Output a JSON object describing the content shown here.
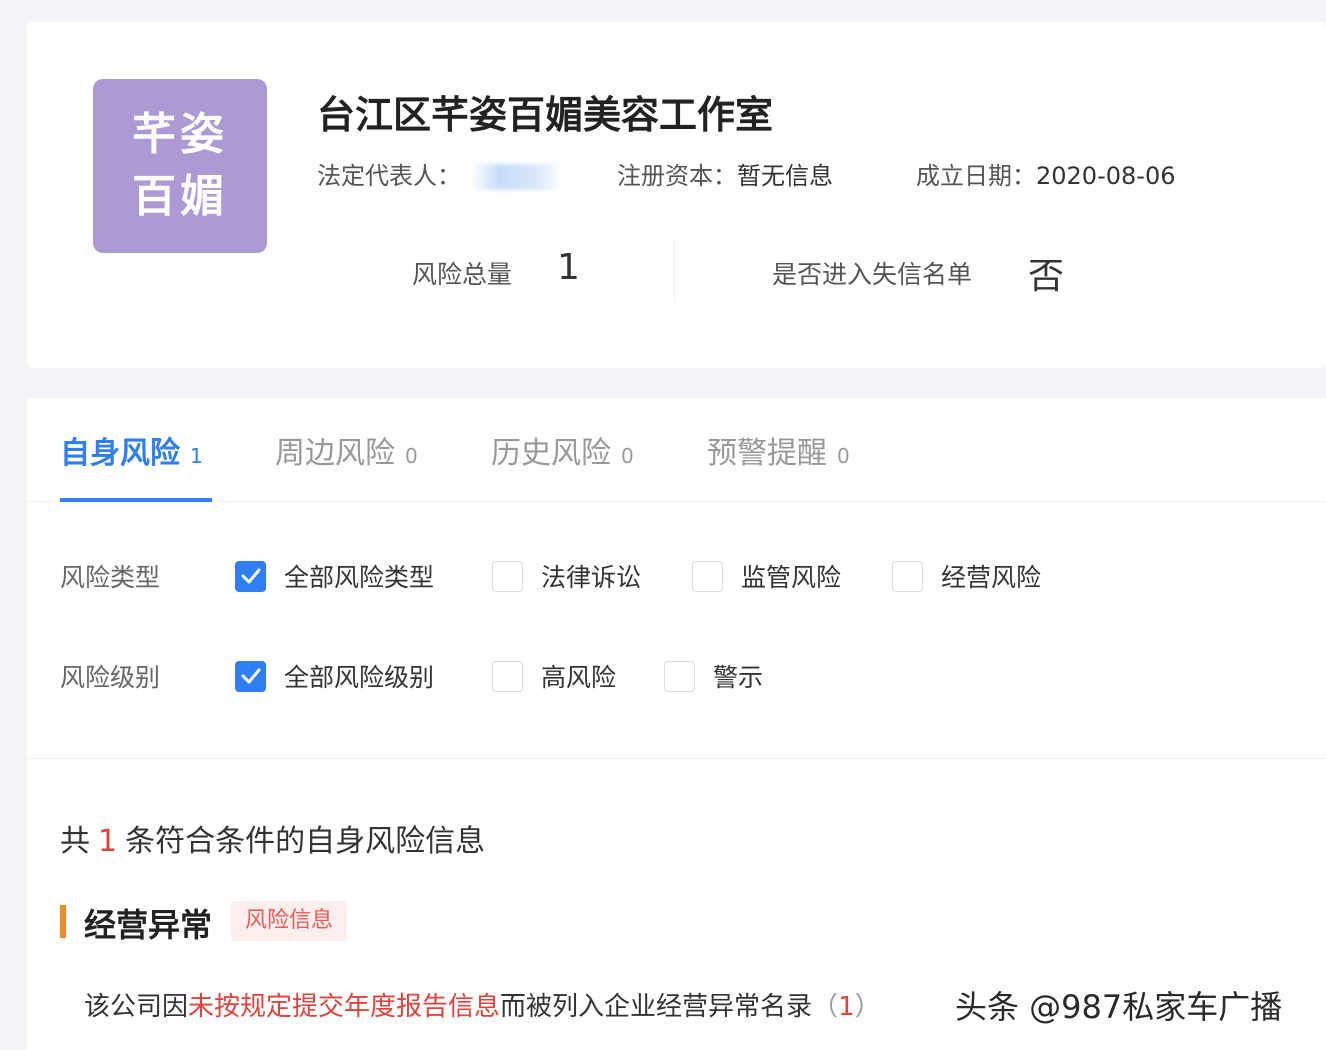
{
  "header": {
    "logo_line1": "芊姿",
    "logo_line2": "百媚",
    "company_name": "台江区芊姿百媚美容工作室",
    "legal_rep_label": "法定代表人：",
    "reg_capital_label": "注册资本：",
    "reg_capital_value": "暂无信息",
    "est_date_label": "成立日期：",
    "est_date_value": "2020-08-06",
    "risk_total_label": "风险总量",
    "risk_total_value": "1",
    "blacklist_label": "是否进入失信名单",
    "blacklist_value": "否"
  },
  "tabs": [
    {
      "label": "自身风险",
      "count": "1"
    },
    {
      "label": "周边风险",
      "count": "0"
    },
    {
      "label": "历史风险",
      "count": "0"
    },
    {
      "label": "预警提醒",
      "count": "0"
    }
  ],
  "filters": {
    "type_label": "风险类型",
    "type_options": [
      "全部风险类型",
      "法律诉讼",
      "监管风险",
      "经营风险"
    ],
    "level_label": "风险级别",
    "level_options": [
      "全部风险级别",
      "高风险",
      "警示"
    ]
  },
  "summary": {
    "prefix": "共",
    "count": "1",
    "suffix": "条符合条件的自身风险信息"
  },
  "section": {
    "title": "经营异常",
    "tag": "风险信息",
    "detail_prefix": "该公司因",
    "detail_highlight": "未按规定提交年度报告信息",
    "detail_suffix": "而被列入企业经营异常名录",
    "detail_paren_open": "（",
    "detail_count": "1",
    "detail_paren_close": "）"
  },
  "watermark": "头条 @987私家车广播",
  "colors": {
    "accent": "#2f7ef2",
    "logo_bg": "#ad9ad4",
    "danger": "#e2423b",
    "section_bar": "#f28a26"
  }
}
